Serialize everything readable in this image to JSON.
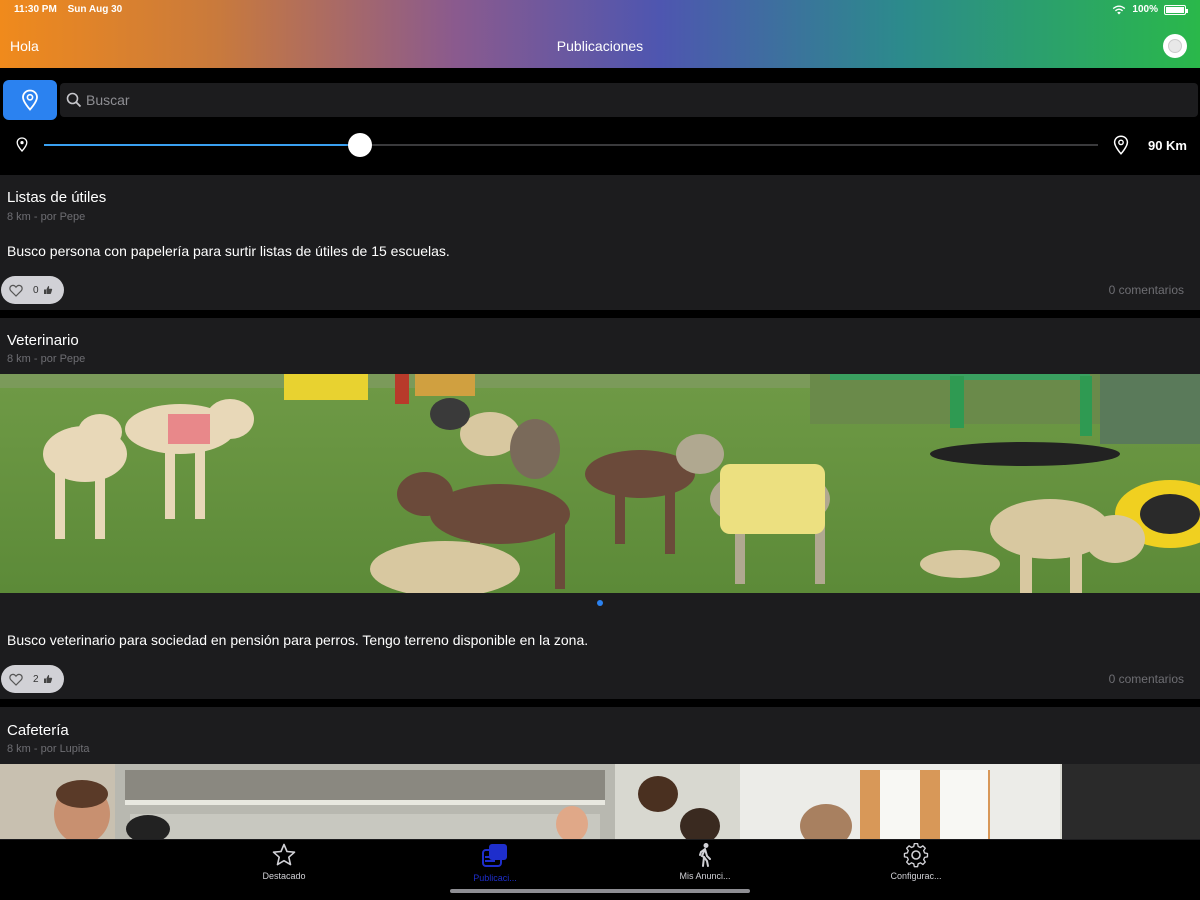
{
  "status_bar": {
    "time": "11:30 PM",
    "date": "Sun Aug 30",
    "battery": "100%"
  },
  "nav": {
    "left_label": "Hola",
    "title": "Publicaciones"
  },
  "search": {
    "placeholder": "Buscar",
    "value": ""
  },
  "distance_slider": {
    "value_label": "90 Km",
    "fill_fraction": 0.3
  },
  "posts": [
    {
      "title": "Listas de útiles",
      "meta": "8 km - por Pepe",
      "body": "Busco persona con papelería para surtir listas de útiles de 15 escuelas.",
      "likes": "0",
      "comments": "0 comentarios",
      "image": "none"
    },
    {
      "title": "Veterinario",
      "meta": "8 km - por Pepe",
      "body": "Busco veterinario para sociedad en pensión para perros. Tengo terreno disponible en la zona.",
      "likes": "2",
      "comments": "0 comentarios",
      "image": "dogs-playing-on-grass-photo"
    },
    {
      "title": "Cafetería",
      "meta": "8 km - por Lupita",
      "image": "cafe-kitchen-photo"
    }
  ],
  "tabbar": {
    "tabs": [
      {
        "label": "Destacado",
        "icon": "star-icon",
        "active": false
      },
      {
        "label": "Publicaci...",
        "icon": "publications-icon",
        "active": true
      },
      {
        "label": "Mis Anunci...",
        "icon": "walking-person-icon",
        "active": false
      },
      {
        "label": "Configurac...",
        "icon": "gear-icon",
        "active": false
      }
    ]
  },
  "colors": {
    "accent": "#2b82f0",
    "active_tab": "#1e2ecc",
    "card_bg": "#1c1c1e",
    "slider_fill": "#3aa0f0"
  }
}
